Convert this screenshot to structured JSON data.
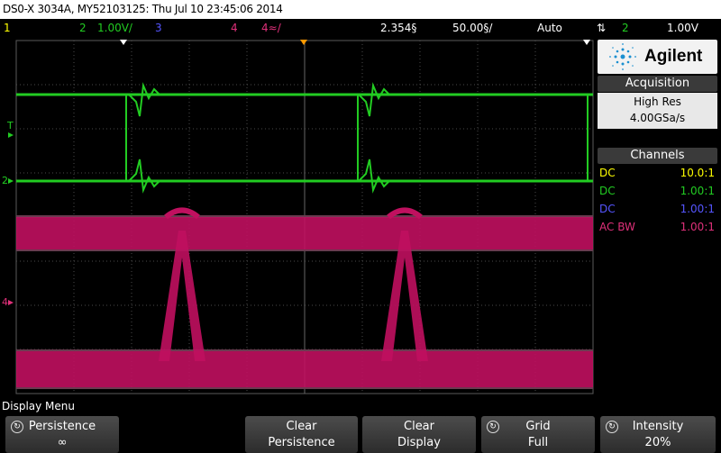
{
  "title": "DS0-X 3034A, MY52103125: Thu Jul 10 23:45:06 2014",
  "status": {
    "ch1_num": "1",
    "ch2_num": "2",
    "ch2_scale": "1.00V/",
    "ch3_num": "3",
    "ch4_num": "4",
    "ch4_scale": "4≈/",
    "time_scale": "2.354§",
    "time_div": "50.00§/",
    "mode": "Auto",
    "trig_icon": "trigger-edge-icon",
    "trig_ch": "2",
    "trig_level": "1.00V"
  },
  "colors": {
    "ch1": "#ffff00",
    "ch2": "#22cc22",
    "ch3": "#4444ff",
    "ch4": "#d01a6a",
    "grid": "#505050",
    "trigger": "#ff9900"
  },
  "panel": {
    "brand": "Agilent",
    "acq_head": "Acquisition",
    "acq_mode": "High Res",
    "acq_rate": "4.00GSa/s",
    "ch_head": "Channels",
    "channels": [
      {
        "coupling": "DC",
        "ratio": "10.0:1"
      },
      {
        "coupling": "DC",
        "ratio": "1.00:1"
      },
      {
        "coupling": "DC",
        "ratio": "1.00:1"
      },
      {
        "coupling": "AC BW",
        "ratio": "1.00:1"
      }
    ]
  },
  "markers": {
    "trig": "T",
    "ch2": "2",
    "ch4": "4"
  },
  "menu_title": "Display Menu",
  "softkeys": [
    {
      "line1": "Persistence",
      "line2": "∞"
    },
    {
      "line1": "Clear",
      "line2": "Persistence"
    },
    {
      "line1": "Clear",
      "line2": "Display"
    },
    {
      "line1": "Grid",
      "line2": "Full"
    },
    {
      "line1": "Intensity",
      "line2": "20%"
    }
  ]
}
